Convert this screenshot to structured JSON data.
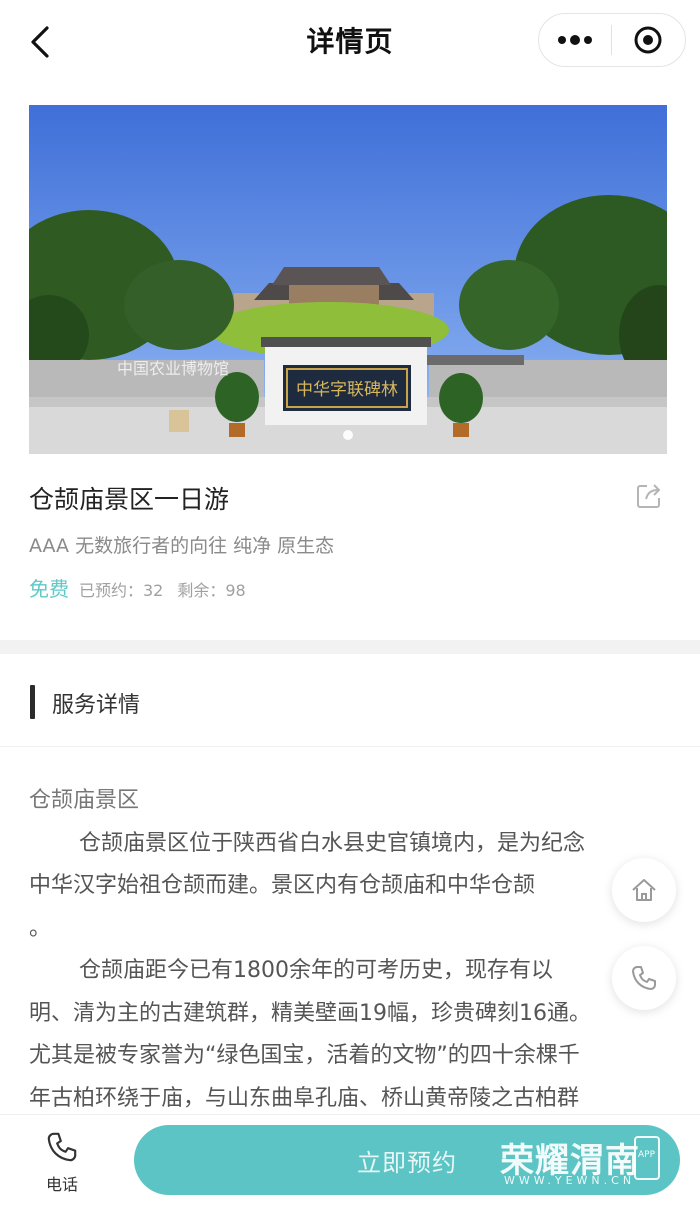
{
  "nav": {
    "title": "详情页"
  },
  "hero": {
    "watermark": "中国农业博物馆",
    "stele_text": "中华字联碑林"
  },
  "detail": {
    "title": "仓颉庙景区一日游",
    "subtitle": "AAA 无数旅行者的向往 纯净 原生态",
    "price": "免费",
    "booked": "已预约：32",
    "remaining": "剩余：98"
  },
  "section": {
    "title": "服务详情"
  },
  "article": {
    "heading": "仓颉庙景区",
    "lines": [
      "仓颉庙景区位于陕西省白水县史官镇境内，是为纪念",
      "中华汉字始祖仓颉而建。景区内有仓颉庙和中华仓颉",
      "。",
      "仓颉庙距今已有1800余年的可考历史，现存有以",
      "明、清为主的古建筑群，精美壁画19幅，珍贵碑刻16通。",
      "尤其是被专家誉为“绿色国宝，活着的文物”的四十余棵千",
      "年古柏环绕于庙，与山东曲阜孔庙、桥山黄帝陵之古柏群"
    ]
  },
  "bottom": {
    "call_label": "电话",
    "book_label": "立即预约"
  },
  "brand": {
    "name": "荣耀渭南",
    "url": "WWW.YEWN.CN",
    "badge": "APP"
  },
  "colors": {
    "accent": "#5cc4c4",
    "price": "#5fc8c8",
    "sky": "#4a78d8"
  },
  "icons": {
    "back": "chevron-left-icon",
    "more": "more-dots-icon",
    "record": "target-circle-icon",
    "share": "share-icon",
    "home": "home-icon",
    "phone": "phone-icon"
  }
}
